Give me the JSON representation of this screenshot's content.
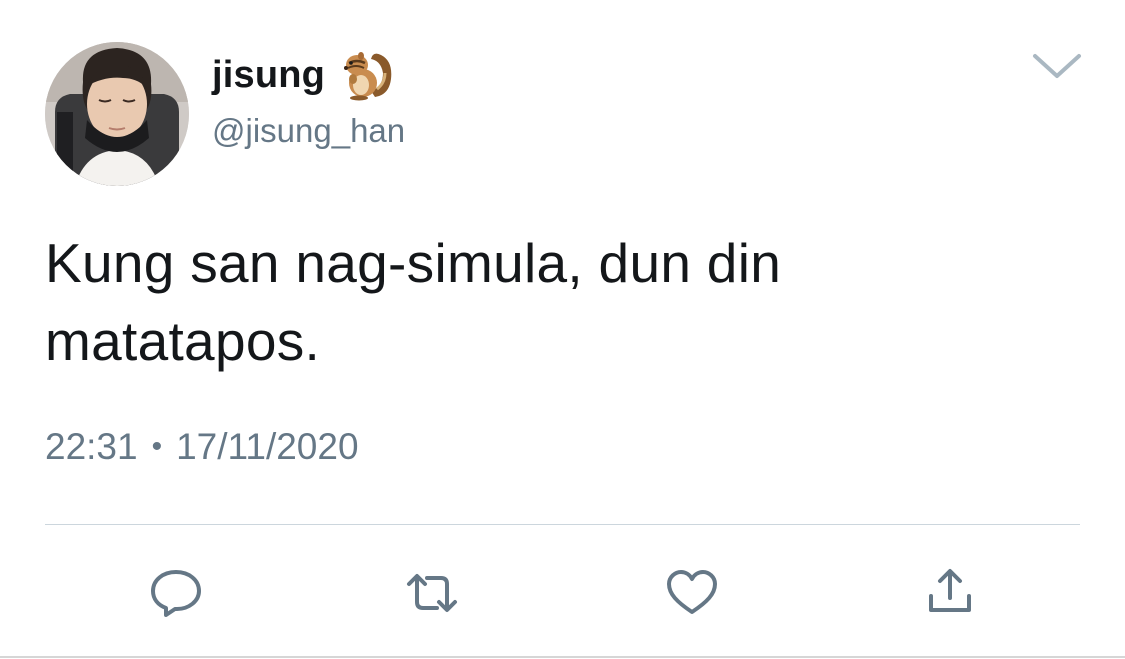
{
  "user": {
    "display_name": "jisung",
    "name_emoji": "chipmunk-emoji",
    "handle": "@jisung_han",
    "avatar": "profile-photo"
  },
  "tweet": {
    "text_line1": "Kung san nag-simula, dun din",
    "text_line2": "matatapos."
  },
  "meta": {
    "time": "22:31",
    "separator": "•",
    "date": "17/11/2020"
  },
  "actions": [
    {
      "name": "reply",
      "icon": "speech-bubble-icon"
    },
    {
      "name": "retweet",
      "icon": "retweet-arrows-icon"
    },
    {
      "name": "like",
      "icon": "heart-icon"
    },
    {
      "name": "share",
      "icon": "share-upload-icon"
    }
  ],
  "colors": {
    "text": "#14171a",
    "secondary": "#657786",
    "icon": "#657786",
    "divider": "#ccd6dd"
  }
}
